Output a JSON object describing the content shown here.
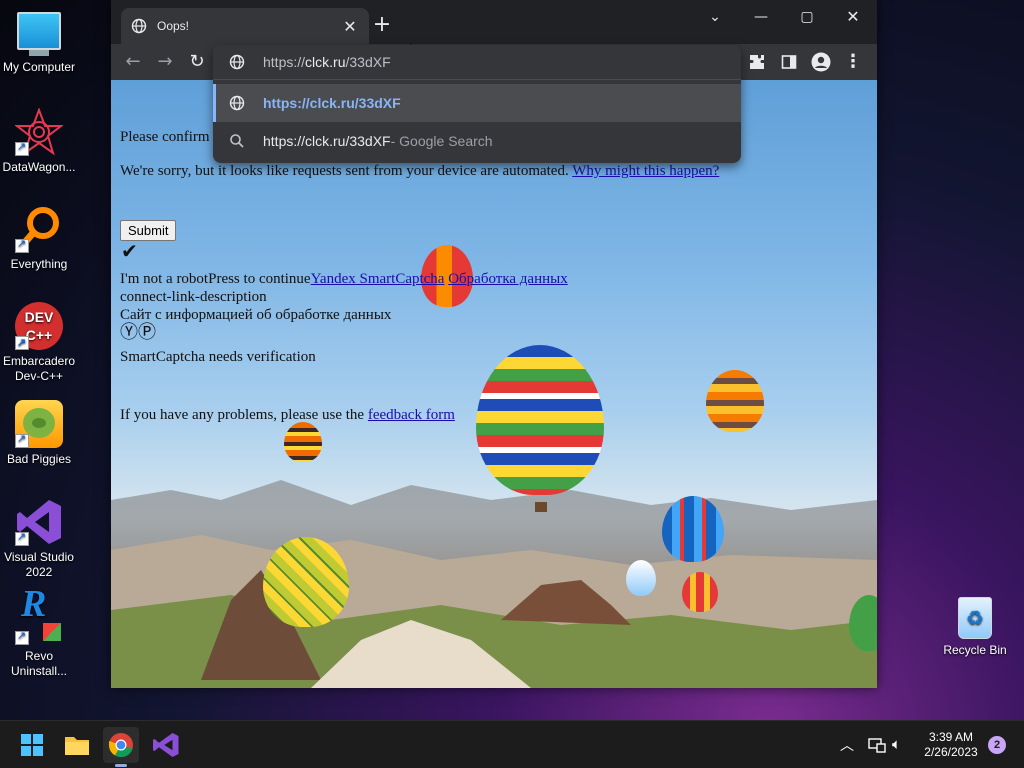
{
  "desktop": {
    "icons": [
      {
        "label": "My Computer",
        "icon": "monitor-icon"
      },
      {
        "label": "DataWagon...",
        "icon": "datawagon-icon"
      },
      {
        "label": "Everything",
        "icon": "magnifier-icon"
      },
      {
        "label": "Embarcadero Dev-C++",
        "icon": "devcpp-icon"
      },
      {
        "label": "Bad Piggies",
        "icon": "pig-icon"
      },
      {
        "label": "Visual Studio 2022",
        "icon": "visualstudio-icon"
      },
      {
        "label": "Revo Uninstall...",
        "icon": "revo-icon"
      }
    ],
    "recycle_bin": {
      "label": "Recycle Bin",
      "icon": "recycle-bin-icon"
    }
  },
  "browser": {
    "tab": {
      "title": "Oops!"
    },
    "window_controls": {
      "tabsearch": "⌄",
      "minimize": "—",
      "maximize": "▢",
      "close": "✕"
    },
    "address": {
      "prefix": "https://",
      "host": "clck.ru",
      "path": "/33dXF"
    },
    "suggestions": [
      {
        "url": "https://clck.ru/33dXF",
        "suffix": ""
      },
      {
        "url": "https://clck.ru/33dXF",
        "suffix": " - Google Search"
      }
    ]
  },
  "page": {
    "confirm_text": "Please confirm",
    "sorry_text": "We're sorry, but it looks like requests sent from your device are automated.",
    "why_link": "Why might this happen?",
    "submit_label": "Submit",
    "checkmark": "✔",
    "robot_text": "I'm not a robotPress to continue",
    "yandex_link": "Yandex SmartCaptcha",
    "data_link": "Обработка данных",
    "connect_desc": "connect-link-description",
    "site_info": "Сайт с информацией об обработке данных",
    "logo_glyphs": "Ⓨ",
    "needs_verification": "SmartCaptcha needs verification",
    "problems_text": "If you have any problems, please use the",
    "feedback_link": "feedback form"
  },
  "taskbar": {
    "time": "3:39 AM",
    "date": "2/26/2023",
    "notification_count": "2"
  },
  "colors": {
    "accent": "#8ab4f8",
    "taskbar": "#1c1c1c",
    "chrome_dark": "#202124"
  }
}
